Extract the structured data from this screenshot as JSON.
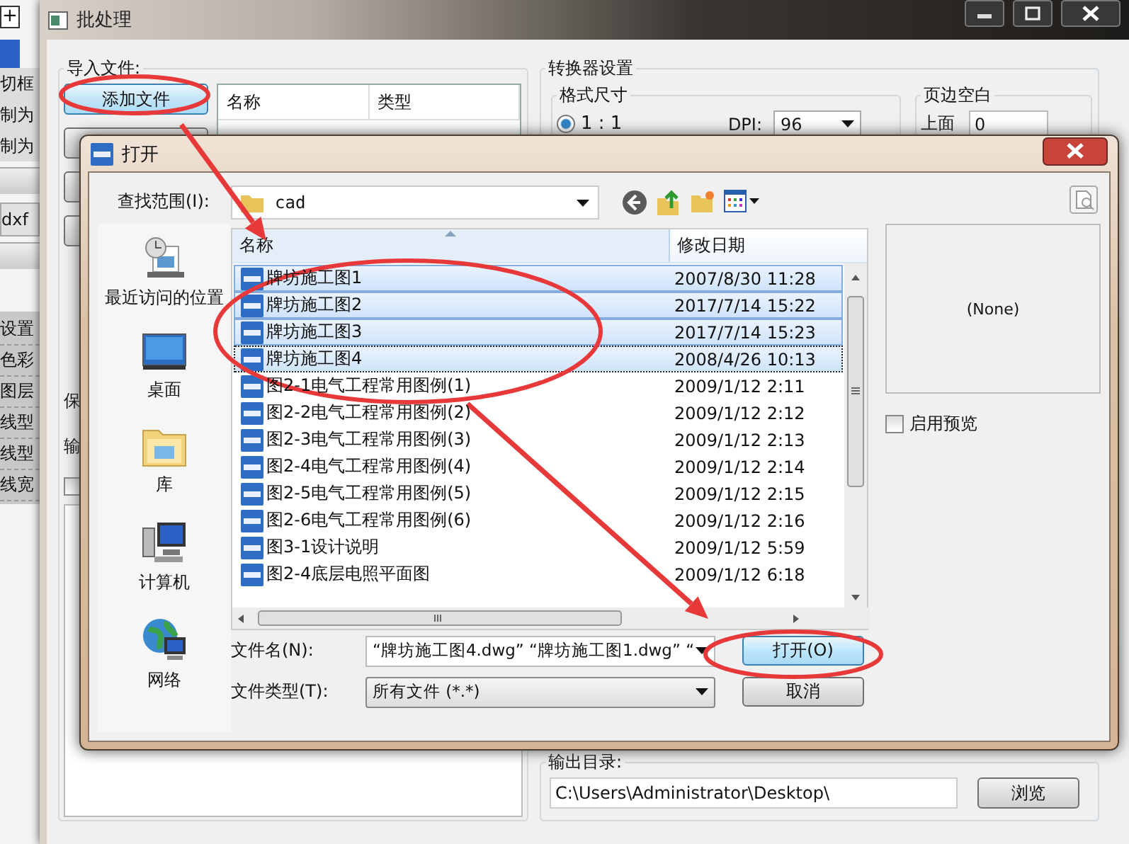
{
  "background_app": {
    "add_button": "+",
    "labels": [
      "切框",
      "制为",
      "制为"
    ],
    "format_tab": "dxf",
    "settings_items": [
      "设置",
      "色彩",
      "图层",
      "线型",
      "线型",
      "线宽"
    ]
  },
  "window": {
    "title": "批处理"
  },
  "import_files": {
    "title": "导入文件:",
    "add_button": "添加文件",
    "list_columns": [
      "名称",
      "类型"
    ],
    "cut_labels": [
      "保",
      "输"
    ],
    "checkbox": {
      "checked": false
    }
  },
  "converter_settings": {
    "title": "转换器设置",
    "format_size": {
      "title": "格式尺寸",
      "scale_option": {
        "label": "1 : 1",
        "selected": true
      },
      "dpi_label": "DPI:",
      "dpi_value": "96"
    },
    "margins": {
      "title": "页边空白",
      "top_label": "上面",
      "top_value": "0"
    }
  },
  "output": {
    "title": "输出目录:",
    "path": "C:\\Users\\Administrator\\Desktop\\",
    "browse_button": "浏览"
  },
  "open_dialog": {
    "title": "打开",
    "look_in_label": "查找范围(I):",
    "look_in_value": "cad",
    "places": [
      {
        "label": "最近访问的位置",
        "kind": "recent",
        "selected": false
      },
      {
        "label": "桌面",
        "kind": "desktop",
        "selected": false
      },
      {
        "label": "库",
        "kind": "library",
        "selected": false
      },
      {
        "label": "计算机",
        "kind": "computer",
        "selected": false
      },
      {
        "label": "网络",
        "kind": "network",
        "selected": false
      }
    ],
    "columns": [
      "名称",
      "修改日期"
    ],
    "files": [
      {
        "name": "牌坊施工图1",
        "date": "2007/8/30 11:28",
        "selected": true,
        "focused": false
      },
      {
        "name": "牌坊施工图2",
        "date": "2017/7/14 15:22",
        "selected": true,
        "focused": false
      },
      {
        "name": "牌坊施工图3",
        "date": "2017/7/14 15:23",
        "selected": true,
        "focused": false
      },
      {
        "name": "牌坊施工图4",
        "date": "2008/4/26 10:13",
        "selected": true,
        "focused": true
      },
      {
        "name": "图2-1电气工程常用图例(1)",
        "date": "2009/1/12 2:11",
        "selected": false,
        "focused": false
      },
      {
        "name": "图2-2电气工程常用图例(2)",
        "date": "2009/1/12 2:12",
        "selected": false,
        "focused": false
      },
      {
        "name": "图2-3电气工程常用图例(3)",
        "date": "2009/1/12 2:13",
        "selected": false,
        "focused": false
      },
      {
        "name": "图2-4电气工程常用图例(4)",
        "date": "2009/1/12 2:14",
        "selected": false,
        "focused": false
      },
      {
        "name": "图2-5电气工程常用图例(5)",
        "date": "2009/1/12 2:15",
        "selected": false,
        "focused": false
      },
      {
        "name": "图2-6电气工程常用图例(6)",
        "date": "2009/1/12 2:16",
        "selected": false,
        "focused": false
      },
      {
        "name": "图3-1设计说明",
        "date": "2009/1/12 5:59",
        "selected": false,
        "focused": false
      },
      {
        "name": "图2-4底层电照平面图",
        "date": "2009/1/12 6:18",
        "selected": false,
        "focused": false
      }
    ],
    "preview": {
      "text": "(None)",
      "enable_label": "启用预览",
      "enabled": false
    },
    "file_name_label": "文件名(N):",
    "file_name_value": "“牌坊施工图4.dwg” “牌坊施工图1.dwg” “",
    "open_button": "打开(O)",
    "file_type_label": "文件类型(T):",
    "file_type_value": "所有文件 (*.*)",
    "cancel_button": "取消"
  }
}
